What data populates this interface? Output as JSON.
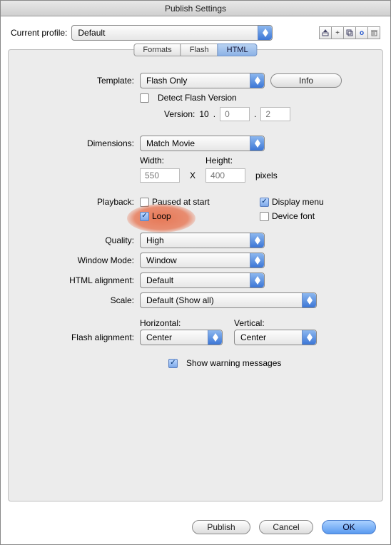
{
  "window": {
    "title": "Publish Settings"
  },
  "profile": {
    "label": "Current profile:",
    "value": "Default"
  },
  "tabs": {
    "formats": "Formats",
    "flash": "Flash",
    "html": "HTML"
  },
  "labels": {
    "template": "Template:",
    "info": "Info",
    "detect_flash": "Detect Flash Version",
    "version": "Version:",
    "version_major": "10",
    "version_minor": "0",
    "version_rev": "2",
    "dimensions": "Dimensions:",
    "width": "Width:",
    "height": "Height:",
    "width_val": "550",
    "height_val": "400",
    "x_sep": "X",
    "pixels": "pixels",
    "playback": "Playback:",
    "paused": "Paused at start",
    "display_menu": "Display menu",
    "loop": "Loop",
    "device_font": "Device font",
    "quality": "Quality:",
    "window_mode": "Window Mode:",
    "html_alignment": "HTML alignment:",
    "scale": "Scale:",
    "horizontal": "Horizontal:",
    "vertical": "Vertical:",
    "flash_alignment": "Flash alignment:",
    "show_warning": "Show warning messages"
  },
  "selects": {
    "template": "Flash Only",
    "dimensions": "Match Movie",
    "quality": "High",
    "window_mode": "Window",
    "html_alignment": "Default",
    "scale": "Default (Show all)",
    "horizontal": "Center",
    "vertical": "Center"
  },
  "buttons": {
    "publish": "Publish",
    "cancel": "Cancel",
    "ok": "OK"
  },
  "dot": "."
}
